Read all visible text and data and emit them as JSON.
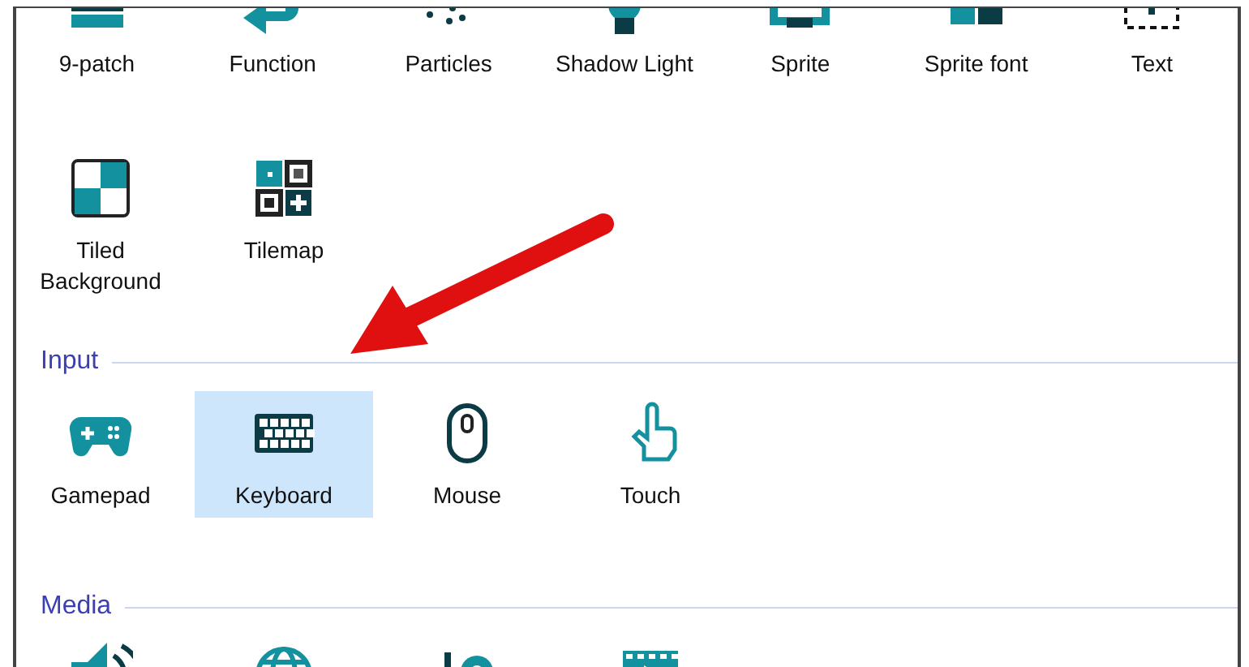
{
  "sections": [
    {
      "items": [
        {
          "kind": "ninepatch",
          "label": "9-patch",
          "selected": false
        },
        {
          "kind": "function",
          "label": "Function",
          "selected": false
        },
        {
          "kind": "particles",
          "label": "Particles",
          "selected": false
        },
        {
          "kind": "bulb",
          "label": "Shadow Light",
          "selected": false
        },
        {
          "kind": "sprite",
          "label": "Sprite",
          "selected": false
        },
        {
          "kind": "spritefont",
          "label": "Sprite font",
          "selected": false
        },
        {
          "kind": "text",
          "label": "Text",
          "selected": false
        }
      ]
    },
    {
      "items": [
        {
          "kind": "tiled",
          "label": "Tiled Background",
          "selected": false
        },
        {
          "kind": "tilemap",
          "label": "Tilemap",
          "selected": false
        }
      ]
    },
    {
      "title": "Input",
      "items": [
        {
          "kind": "gamepad",
          "label": "Gamepad",
          "selected": false
        },
        {
          "kind": "keyboard",
          "label": "Keyboard",
          "selected": true
        },
        {
          "kind": "mouse",
          "label": "Mouse",
          "selected": false
        },
        {
          "kind": "touch",
          "label": "Touch",
          "selected": false
        }
      ]
    },
    {
      "title": "Media",
      "items": [
        {
          "kind": "speaker",
          "selected": false
        },
        {
          "kind": "globe",
          "selected": false
        },
        {
          "kind": "camera",
          "selected": false
        },
        {
          "kind": "film",
          "selected": false
        }
      ]
    }
  ]
}
